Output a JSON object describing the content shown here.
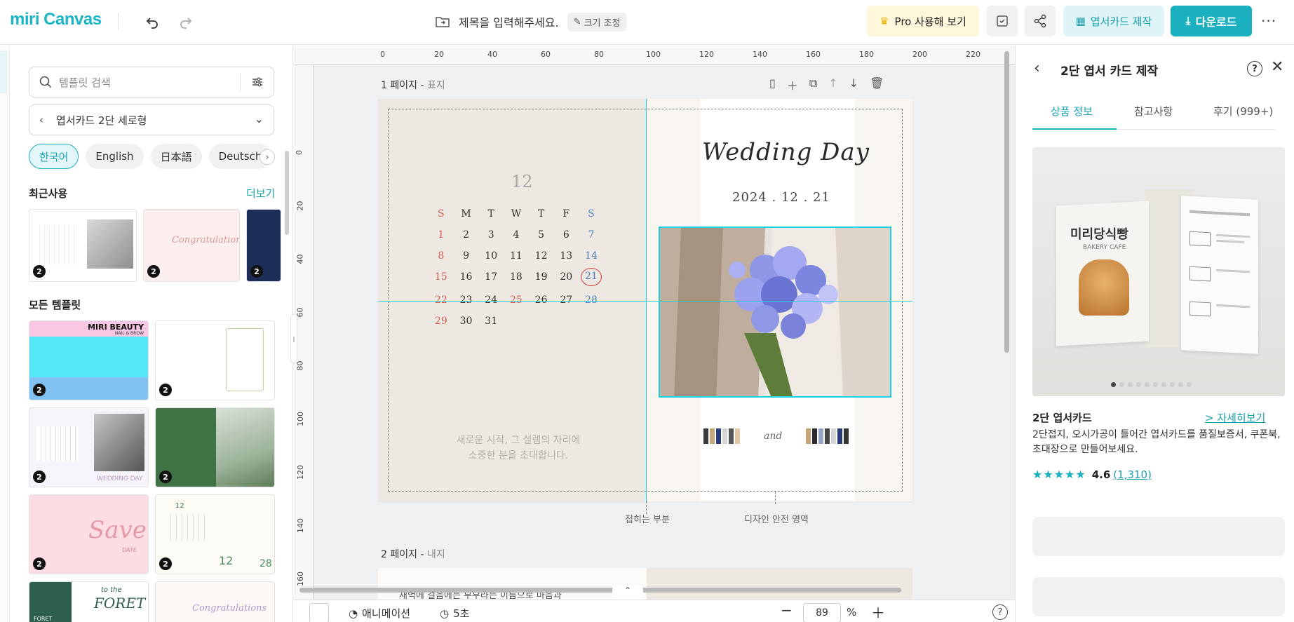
{
  "topbar": {
    "logo": "miri Canvas",
    "doc_title_placeholder": "제목을 입력해주세요.",
    "resize_label": "크기 조정",
    "pro_label": "Pro 사용해 보기",
    "make_postcard_label": "엽서카드 제작",
    "download_label": "다운로드",
    "more_label": "···"
  },
  "left_panel": {
    "search_placeholder": "템플릿 검색",
    "category": "엽서카드 2단 세로형",
    "languages": [
      {
        "label": "한국어",
        "active": true
      },
      {
        "label": "English",
        "active": false
      },
      {
        "label": "日本語",
        "active": false
      },
      {
        "label": "Deutsch",
        "active": false
      }
    ],
    "recent_title": "최근사용",
    "recent_more": "더보기",
    "recent_badges": [
      "2",
      "2",
      "2"
    ],
    "all_title": "모든 템플릿",
    "template_badges": [
      "2",
      "2",
      "2",
      "2",
      "2",
      "2"
    ],
    "template_texts": {
      "miri_beauty": "MIRI BEAUTY",
      "miri_beauty_sub": "NAIL & BROW",
      "wedding_day": "WEDDING DAY",
      "save_date": "Save",
      "save_date_sub": "DATE",
      "twelve": "12",
      "twenty_eight": "28",
      "foret_prefix": "to the",
      "foret": "FORET",
      "foret_left": "FORET",
      "congrats": "Congratulations"
    }
  },
  "canvas": {
    "ruler_top": [
      "0",
      "20",
      "40",
      "60",
      "80",
      "100",
      "120",
      "140",
      "160",
      "180",
      "200",
      "220"
    ],
    "ruler_left": [
      "0",
      "20",
      "40",
      "60",
      "80",
      "100",
      "120",
      "140",
      "160"
    ],
    "page1_label": "1 페이지 -",
    "page1_sub": "표지",
    "page2_label": "2 페이지 -",
    "page2_sub": "내지",
    "calendar": {
      "month": "12",
      "weekdays": [
        "S",
        "M",
        "T",
        "W",
        "T",
        "F",
        "S"
      ],
      "rows": [
        [
          "1",
          "2",
          "3",
          "4",
          "5",
          "6",
          "7"
        ],
        [
          "8",
          "9",
          "10",
          "11",
          "12",
          "13",
          "14"
        ],
        [
          "15",
          "16",
          "17",
          "18",
          "19",
          "20",
          "21"
        ],
        [
          "22",
          "23",
          "24",
          "25",
          "26",
          "27",
          "28"
        ],
        [
          "29",
          "30",
          "31",
          "",
          "",
          "",
          ""
        ]
      ],
      "highlight": "21",
      "holiday": "25"
    },
    "invite_line1": "새로운 시작, 그 설렘의 자리에",
    "invite_line2": "소중한 분을 초대합니다.",
    "wedding_title": "Wedding Day",
    "wedding_date": "2024 . 12 . 21",
    "names_and": "and",
    "fold_label": "접히는 부분",
    "safe_label": "디자인 안전 영역",
    "page2_text": "새벽에 걸음에는 부부라는 이름으로 마음과"
  },
  "bottombar": {
    "animation_label": "애니메이션",
    "duration_label": "5초",
    "zoom_value": "89",
    "zoom_unit": "%",
    "help": "?"
  },
  "right_panel": {
    "title": "2단 엽서 카드 제작",
    "tabs": [
      "상품 정보",
      "참고사항",
      "후기 (999+)"
    ],
    "active_tab": 0,
    "product_image_title": "미리당식빵",
    "product_image_sub": "BAKERY CAFE",
    "product_name": "2단 엽서카드",
    "detail_link": "> 자세히보기",
    "description": "2단접지, 오시가공이 들어간 엽서카드를 품질보증서, 쿠폰북, 초대장으로 만들어보세요.",
    "rating": "4.6",
    "rating_count": "(1,310)",
    "carousel_dots": 10,
    "carousel_active": 0
  },
  "colors": {
    "accent": "#1ab0bf",
    "pro_bg": "#fdf6da",
    "guide": "#1fd0e0"
  }
}
